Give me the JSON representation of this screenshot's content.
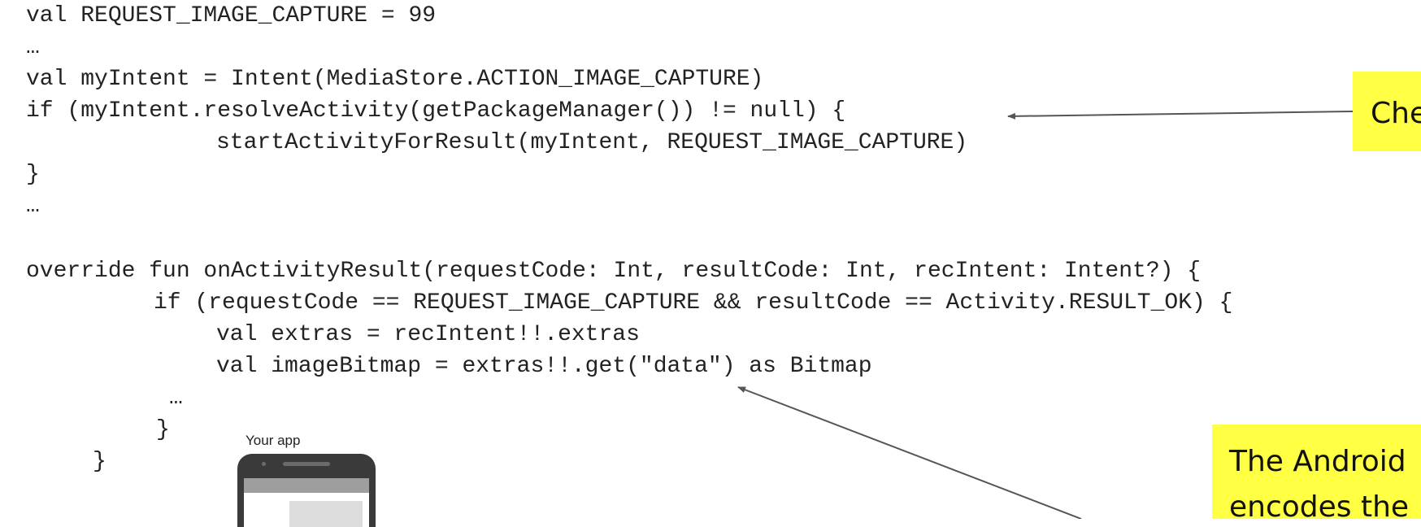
{
  "code": {
    "lines": [
      "val REQUEST_IMAGE_CAPTURE = 99",
      "…",
      "val myIntent = Intent(MediaStore.ACTION_IMAGE_CAPTURE)",
      "if (myIntent.resolveActivity(getPackageManager()) != null) {",
      "startActivityForResult(myIntent, REQUEST_IMAGE_CAPTURE)",
      "}",
      "…",
      "override fun onActivityResult(requestCode: Int, resultCode: Int, recIntent: Intent?) {",
      "if (requestCode == REQUEST_IMAGE_CAPTURE && resultCode == Activity.RESULT_OK) {",
      "val extras = recIntent!!.extras",
      "val imageBitmap = extras!!.get(\"data\") as Bitmap",
      "…",
      "}",
      "}"
    ]
  },
  "callouts": {
    "check": "Che",
    "android": "The Android\nencodes the"
  },
  "phone": {
    "label": "Your app"
  },
  "colors": {
    "callout_bg": "#ffff44",
    "arrow": "#555555"
  }
}
